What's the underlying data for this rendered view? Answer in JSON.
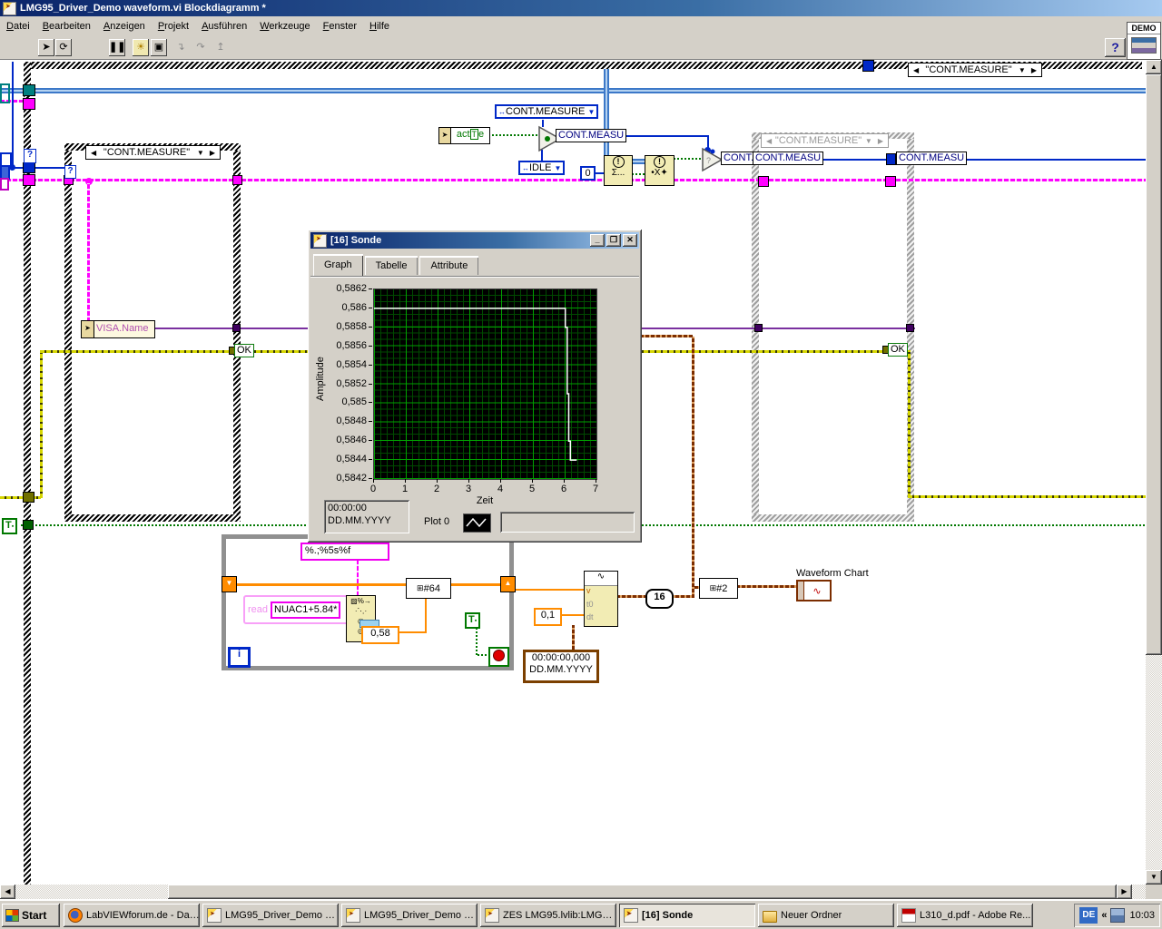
{
  "window": {
    "title": "LMG95_Driver_Demo waveform.vi Blockdiagramm *",
    "controls": {
      "minimize": "_",
      "restore": "❐",
      "close": "✕"
    }
  },
  "menu": {
    "items": [
      "Datei",
      "Bearbeiten",
      "Anzeigen",
      "Projekt",
      "Ausführen",
      "Werkzeuge",
      "Fenster",
      "Hilfe"
    ]
  },
  "toolbar": {
    "demo": "DEMO",
    "help": "?"
  },
  "diagram": {
    "outer_selector": "\"CONT.MEASURE\"",
    "left_selector": "\"CONT.MEASURE\"",
    "disabled_selector": "\"CONT.MEASURE\"",
    "selector_left_arrow": "◀",
    "selector_right_arrow": "▶",
    "selector_down_arrow": "▼",
    "question": "?",
    "enum_cont_measure": "CONT.MEASURE",
    "enum_idle": "IDLE",
    "enum_prefix_icon": "↔",
    "enum_down_icon": "▼",
    "active_pre": "act",
    "active_bool": "T",
    "active_post": "e",
    "lbl_cont_measu": "CONT.MEASU",
    "lbl_cont_short": "CONT..",
    "zero": "0",
    "excl": "!",
    "sum_glyph": "Σ...",
    "mult_glyph": "•X✦",
    "visa_name": "VISA.Name",
    "ok": "OK",
    "bool_T": "T",
    "fmt_string": "%.;%5s%f",
    "read_label": "read",
    "read_value": "NUAC1+5.84*",
    "scan_icon": "▨%→",
    "scan_tip": "0,58",
    "build_array_icon": "⊞",
    "n64": "#64",
    "n2": "#2",
    "probe_num": "16",
    "iter": "i",
    "dt_value": "0,1",
    "ts_line1": "00:00:00,000",
    "ts_line2": "DD.MM.YYYY",
    "wf_icon": "∿",
    "bw_v": "v",
    "bw_t0": "t0",
    "bw_dt": "dt",
    "chart_label": "Waveform Chart",
    "chart_icon": "∿",
    "colors": {
      "string_pink": "#ff00ff",
      "error_yellow": "#d6d600",
      "bool_green": "#007800",
      "numeric_orange": "#ff8c00",
      "enum_blue": "#0028c8",
      "visa_purple": "#7a30a0",
      "waveform_brown": "#7b2d00"
    }
  },
  "probe": {
    "title": "[16] Sonde",
    "tabs": [
      "Graph",
      "Tabelle",
      "Attribute"
    ],
    "active_tab": "Graph",
    "time_line1": "00:00:00",
    "time_line2": "DD.MM.YYYY",
    "plot_label": "Plot 0",
    "chart_data": {
      "type": "line",
      "title": "",
      "xlabel": "Zeit",
      "ylabel": "Amplitude",
      "xlim": [
        0,
        7
      ],
      "ylim": [
        0.5842,
        0.5862
      ],
      "x_ticks": [
        "0",
        "1",
        "2",
        "3",
        "4",
        "5",
        "6",
        "7"
      ],
      "y_ticks": [
        "0,5862",
        "0,586",
        "0,5858",
        "0,5856",
        "0,5854",
        "0,5852",
        "0,585",
        "0,5848",
        "0,5846",
        "0,5844",
        "0,5842"
      ],
      "grid": true,
      "plot_bg": "#000000",
      "line_color": "#ffffff",
      "legend_position": "bottom",
      "series": [
        {
          "name": "Plot 0",
          "points": [
            [
              0,
              0.586
            ],
            [
              6.02,
              0.586
            ],
            [
              6.02,
              0.5858
            ],
            [
              6.08,
              0.5858
            ],
            [
              6.08,
              0.5851
            ],
            [
              6.13,
              0.5851
            ],
            [
              6.13,
              0.5846
            ],
            [
              6.18,
              0.5846
            ],
            [
              6.18,
              0.5844
            ],
            [
              6.38,
              0.5844
            ]
          ]
        }
      ]
    }
  },
  "taskbar": {
    "start": "Start",
    "items": [
      {
        "label": "LabVIEWforum.de - Das...",
        "icon": "firefox",
        "active": false
      },
      {
        "label": "LMG95_Driver_Demo w...",
        "icon": "labview",
        "active": false
      },
      {
        "label": "LMG95_Driver_Demo w...",
        "icon": "labview",
        "active": false
      },
      {
        "label": "ZES LMG95.lvlib:LMG95...",
        "icon": "labview",
        "active": false
      },
      {
        "label": "[16] Sonde",
        "icon": "labview",
        "active": true
      },
      {
        "label": "Neuer Ordner",
        "icon": "folder",
        "active": false
      },
      {
        "label": "L310_d.pdf - Adobe Re...",
        "icon": "pdf",
        "active": false
      }
    ],
    "tray": {
      "lang": "DE",
      "collapse": "«",
      "time": "10:03"
    }
  }
}
